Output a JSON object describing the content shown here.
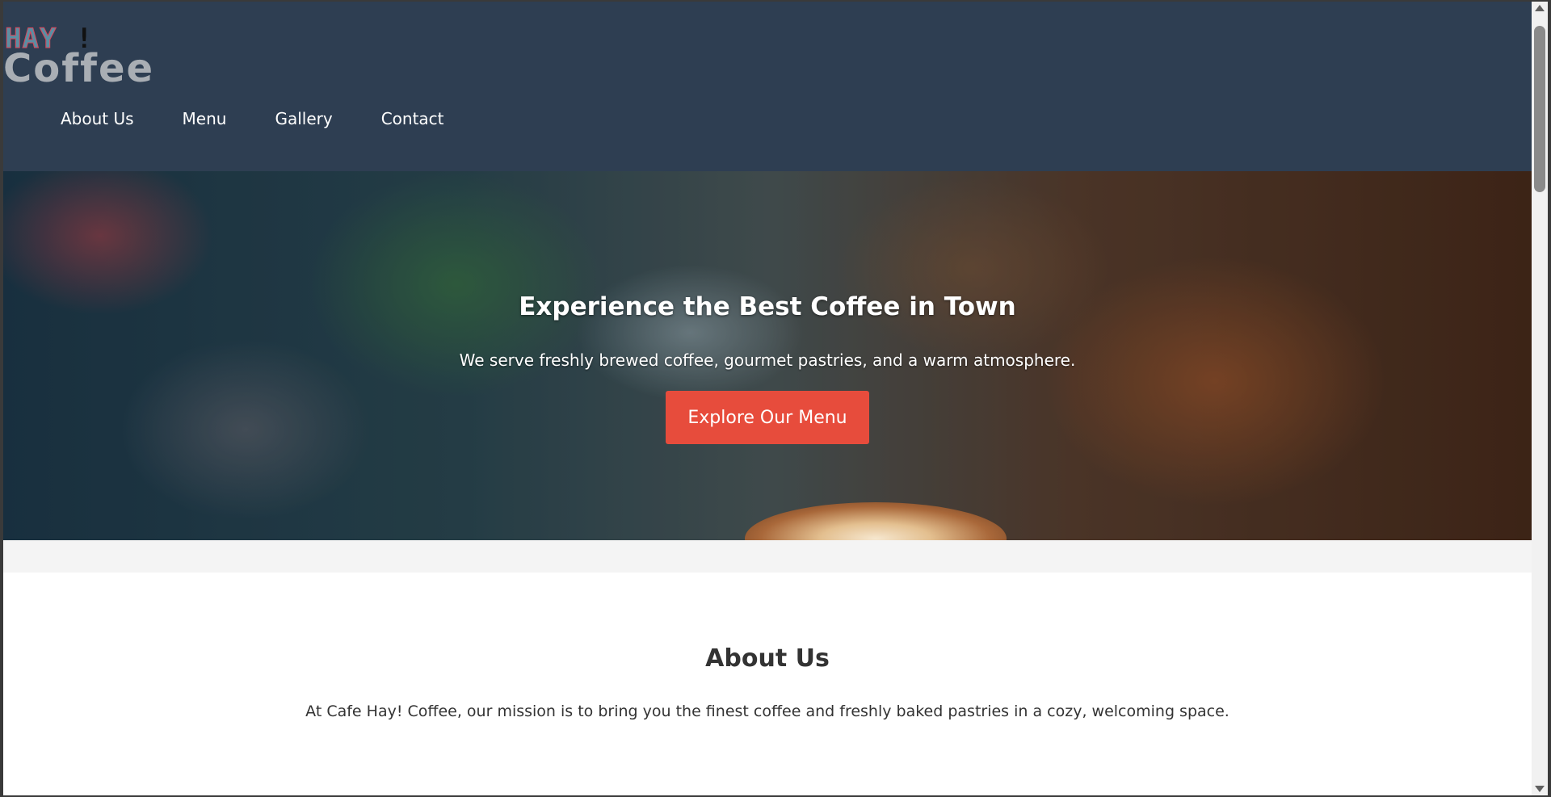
{
  "logo": {
    "top": "HAY",
    "bang": "!",
    "bottom": "Coffee"
  },
  "nav": {
    "items": [
      "About Us",
      "Menu",
      "Gallery",
      "Contact"
    ]
  },
  "hero": {
    "title": "Experience the Best Coffee in Town",
    "subtitle": "We serve freshly brewed coffee, gourmet pastries, and a warm atmosphere.",
    "button_label": "Explore Our Menu"
  },
  "about": {
    "title": "About Us",
    "text": "At Cafe Hay! Coffee, our mission is to bring you the finest coffee and freshly baked pastries in a cozy, welcoming space."
  },
  "colors": {
    "header": "#2e3e52",
    "accent": "#e74c3c",
    "text_dark": "#333333"
  },
  "icons": {
    "water_widget": "water-drop-sparkle-icon"
  }
}
